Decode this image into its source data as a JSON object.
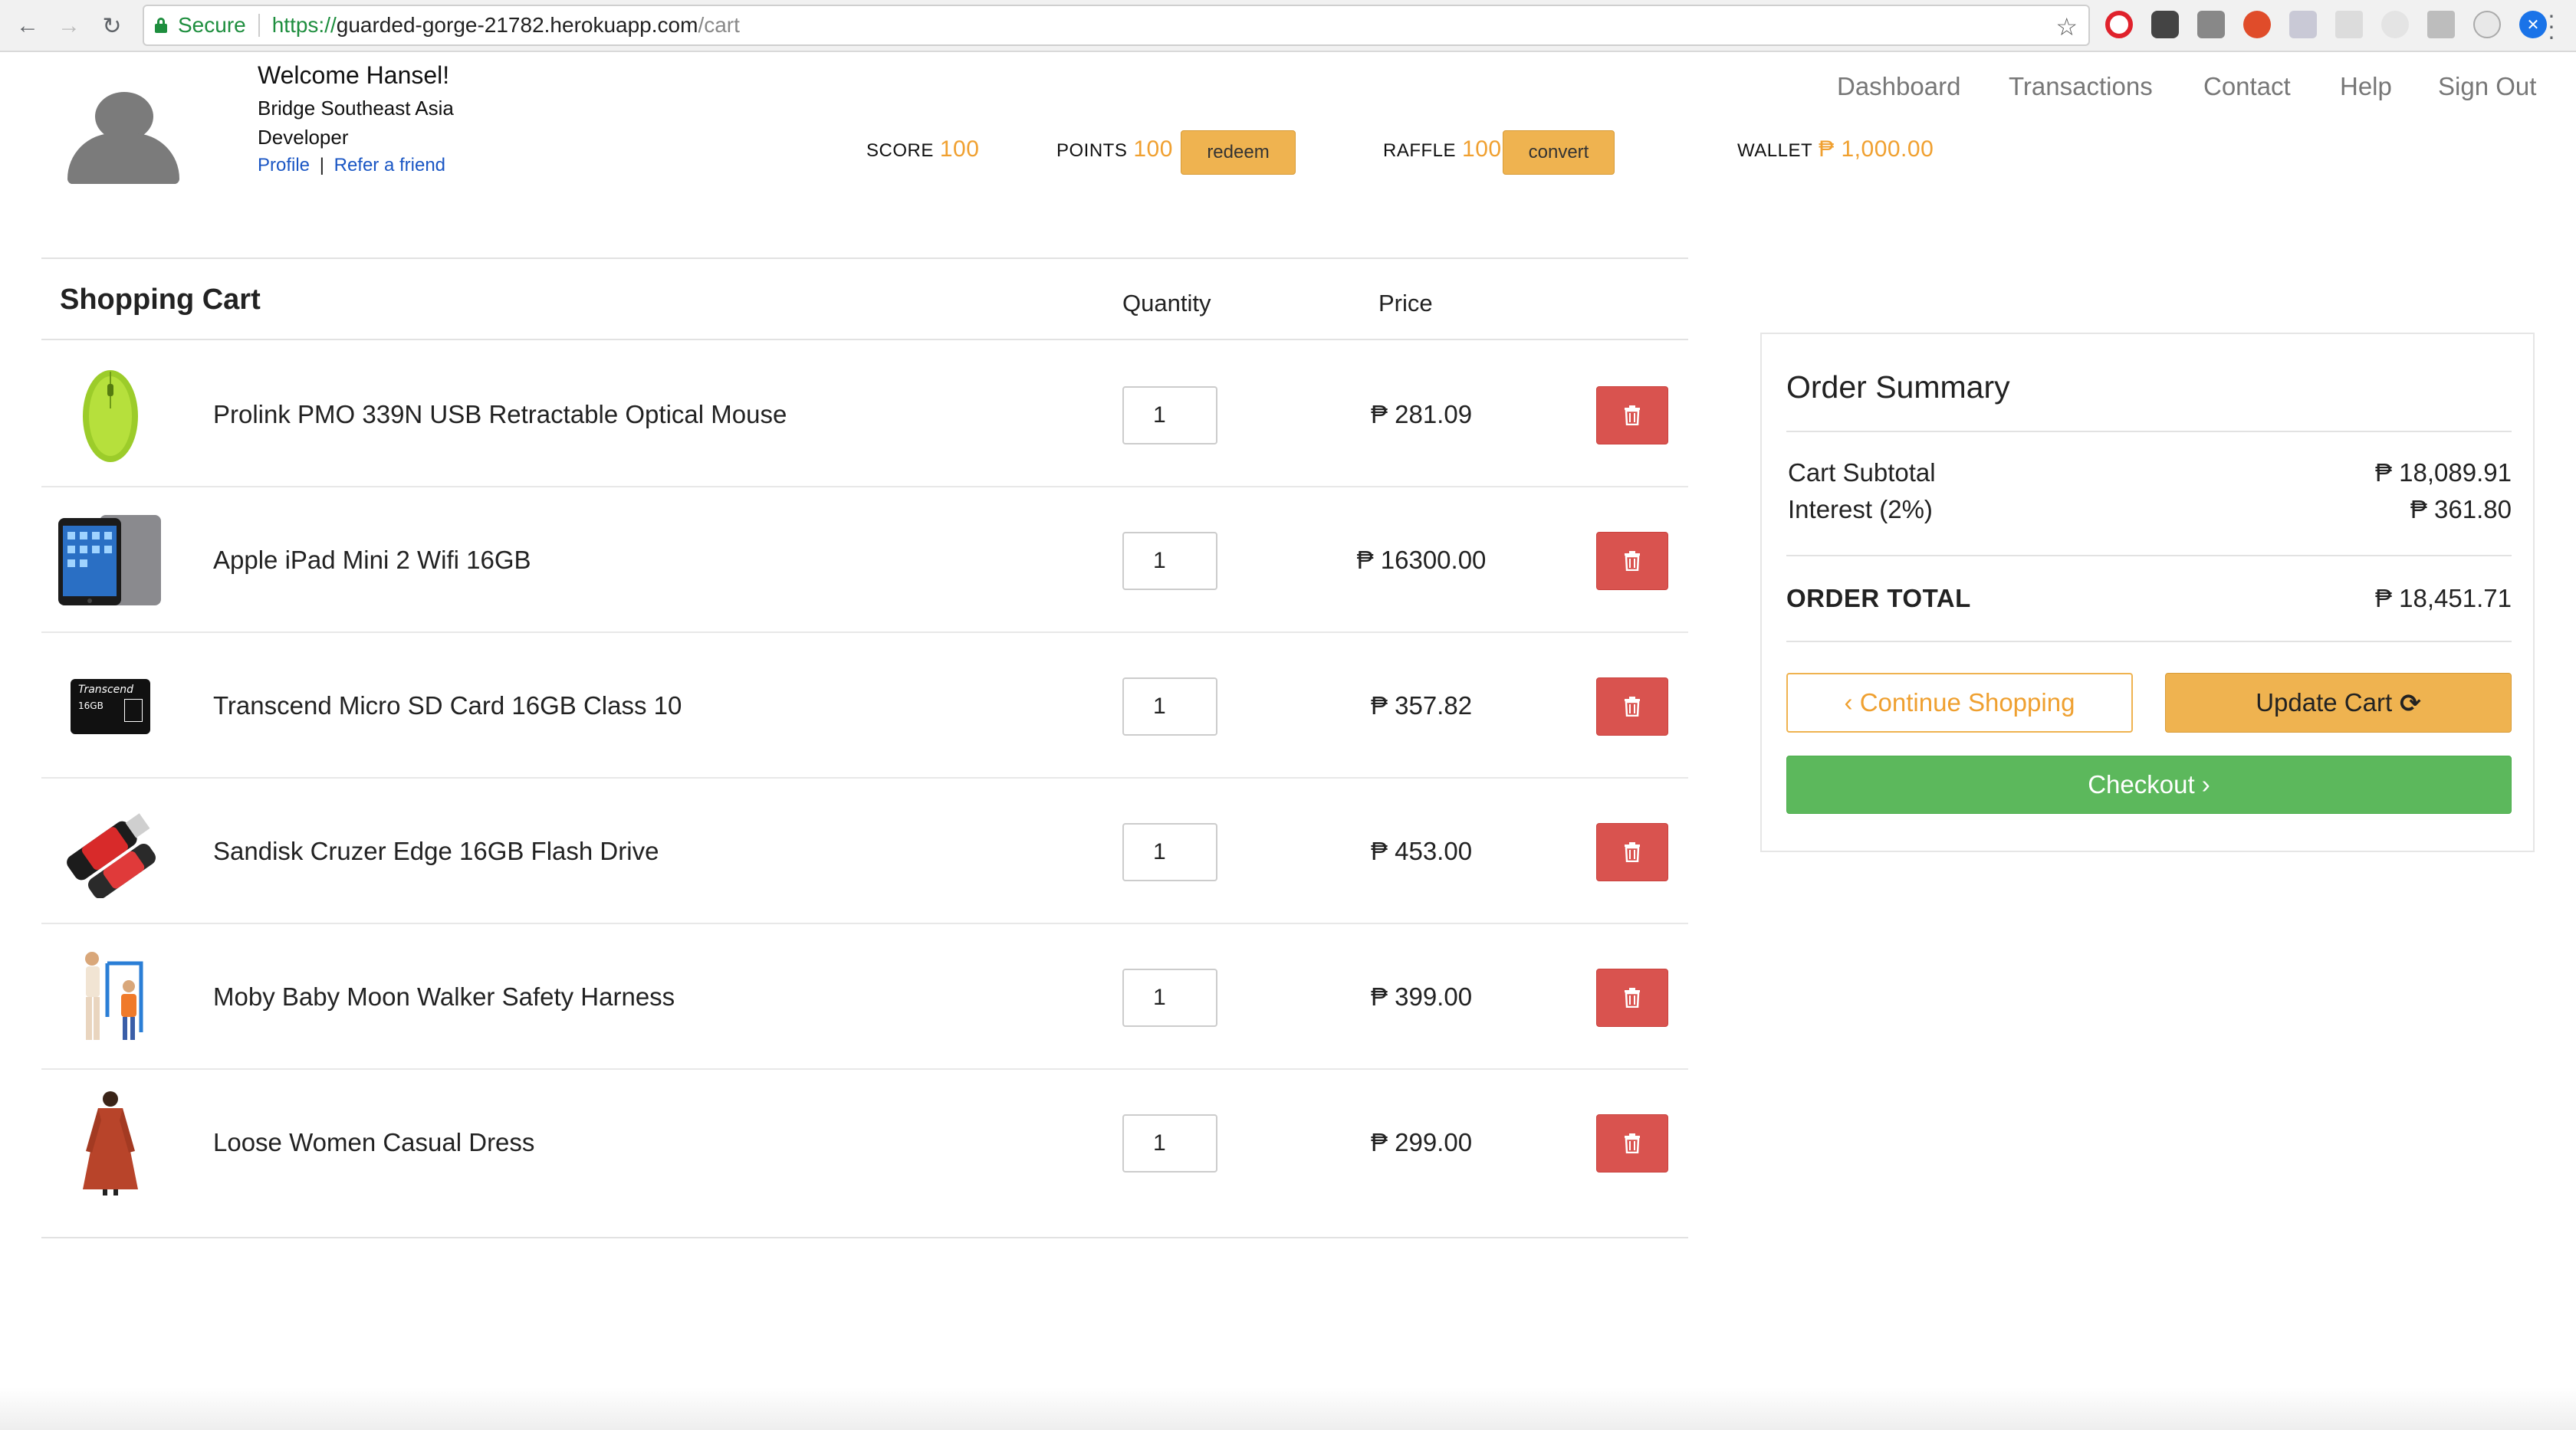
{
  "browser": {
    "secure_label": "Secure",
    "url_scheme": "https://",
    "url_host": "guarded-gorge-21782.herokuapp.com",
    "url_path": "/cart"
  },
  "user": {
    "welcome": "Welcome Hansel!",
    "company": "Bridge Southeast Asia",
    "role": "Developer",
    "profile_link": "Profile",
    "link_separator": "|",
    "refer_link": "Refer a friend"
  },
  "stats": {
    "score_label": "SCORE",
    "score_value": "100",
    "points_label": "POINTS",
    "points_value": "100",
    "redeem_label": "redeem",
    "raffle_label": "RAFFLE",
    "raffle_value": "100",
    "convert_label": "convert",
    "wallet_label": "WALLET",
    "wallet_value": "₱ 1,000.00"
  },
  "nav": {
    "dashboard": "Dashboard",
    "transactions": "Transactions",
    "contact": "Contact",
    "help": "Help",
    "signout": "Sign Out"
  },
  "cart": {
    "title": "Shopping Cart",
    "quantity_header": "Quantity",
    "price_header": "Price",
    "items": [
      {
        "name": "Prolink PMO 339N USB Retractable Optical Mouse",
        "qty": "1",
        "price": "₱ 281.09",
        "image": "green-mouse"
      },
      {
        "name": "Apple iPad Mini 2 Wifi 16GB",
        "qty": "1",
        "price": "₱ 16300.00",
        "image": "ipad"
      },
      {
        "name": "Transcend Micro SD Card 16GB Class 10",
        "qty": "1",
        "price": "₱ 357.82",
        "image": "micro-sd"
      },
      {
        "name": "Sandisk Cruzer Edge 16GB Flash Drive",
        "qty": "1",
        "price": "₱ 453.00",
        "image": "flash-drive"
      },
      {
        "name": "Moby Baby Moon Walker Safety Harness",
        "qty": "1",
        "price": "₱ 399.00",
        "image": "baby-harness"
      },
      {
        "name": "Loose Women Casual Dress",
        "qty": "1",
        "price": "₱ 299.00",
        "image": "dress"
      }
    ],
    "sd_brand": "Transcend",
    "sd_capacity": "16GB"
  },
  "summary": {
    "title": "Order Summary",
    "subtotal_label": "Cart Subtotal",
    "subtotal_value": "₱ 18,089.91",
    "interest_label": "Interest (2%)",
    "interest_value": "₱ 361.80",
    "total_label": "ORDER TOTAL",
    "total_value": "₱ 18,451.71",
    "continue_label": "‹ Continue Shopping",
    "update_label": "Update Cart",
    "checkout_label": "Checkout ›"
  },
  "colors": {
    "accent": "#efb350",
    "accent_text": "#f0a030",
    "danger": "#d9534f",
    "success": "#5cb85c",
    "link": "#1a56c4"
  }
}
